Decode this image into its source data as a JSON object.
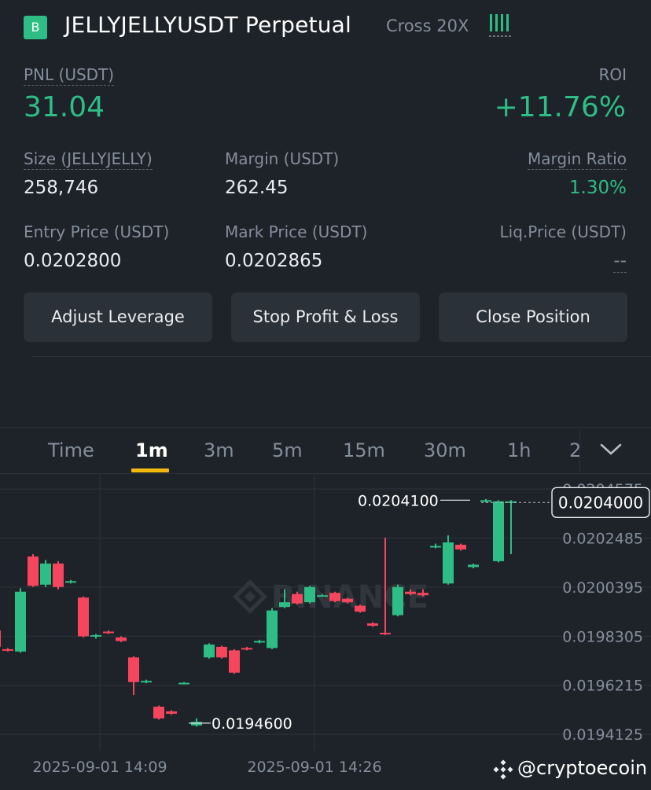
{
  "header": {
    "badge": "B",
    "title": "JELLYJELLYUSDT Perpetual",
    "mode": "Cross 20X",
    "leverage_icon": "leverage-bars-icon"
  },
  "pnl": {
    "label": "PNL (USDT)",
    "value": "31.04"
  },
  "roi": {
    "label": "ROI",
    "value": "+11.76%"
  },
  "size": {
    "label": "Size (JELLYJELLY)",
    "value": "258,746"
  },
  "margin": {
    "label": "Margin (USDT)",
    "value": "262.45"
  },
  "margin_ratio": {
    "label": "Margin Ratio",
    "value": "1.30%"
  },
  "entry_price": {
    "label": "Entry Price (USDT)",
    "value": "0.0202800"
  },
  "mark_price": {
    "label": "Mark Price (USDT)",
    "value": "0.0202865"
  },
  "liq_price": {
    "label": "Liq.Price (USDT)",
    "value": "--"
  },
  "buttons": {
    "adjust_leverage": "Adjust Leverage",
    "stop_profit_loss": "Stop Profit & Loss",
    "close_position": "Close Position"
  },
  "tabs": [
    "Time",
    "1m",
    "3m",
    "5m",
    "15m",
    "30m",
    "1h",
    "2"
  ],
  "active_tab": "1m",
  "colors": {
    "up": "#2ebd85",
    "down": "#f6465d",
    "accent": "#f0b90b",
    "bg": "#1e2329"
  },
  "chart_data": {
    "type": "candlestick",
    "y_ticks": [
      "0.0204575",
      "0.0202485",
      "0.0200395",
      "0.0198305",
      "0.0196215",
      "0.0194125"
    ],
    "x_ticks": [
      "2025-09-01 14:09",
      "2025-09-01 14:26"
    ],
    "current_price": "0.0204000",
    "high_label": "0.0204100",
    "low_label": "0.0194600",
    "watermark": "BINANCE",
    "ylim": [
      0.0193425,
      0.0205215
    ],
    "candles": [
      {
        "o": 0.019855,
        "c": 0.019785,
        "h": 0.01988,
        "l": 0.01977
      },
      {
        "o": 0.019775,
        "c": 0.01977,
        "h": 0.01978,
        "l": 0.019765
      },
      {
        "o": 0.019765,
        "c": 0.02002,
        "h": 0.020035,
        "l": 0.01976
      },
      {
        "o": 0.02017,
        "c": 0.020045,
        "h": 0.02018,
        "l": 0.02004
      },
      {
        "o": 0.02005,
        "c": 0.02014,
        "h": 0.020155,
        "l": 0.02004
      },
      {
        "o": 0.02014,
        "c": 0.02004,
        "h": 0.02015,
        "l": 0.02003
      },
      {
        "o": 0.02006,
        "c": 0.020065,
        "h": 0.02007,
        "l": 0.020055
      },
      {
        "o": 0.019995,
        "c": 0.01983,
        "h": 0.02,
        "l": 0.019825
      },
      {
        "o": 0.01983,
        "c": 0.019835,
        "h": 0.01984,
        "l": 0.01982
      },
      {
        "o": 0.01985,
        "c": 0.019845,
        "h": 0.019855,
        "l": 0.01984
      },
      {
        "o": 0.019825,
        "c": 0.01981,
        "h": 0.01983,
        "l": 0.019805
      },
      {
        "o": 0.01974,
        "c": 0.019635,
        "h": 0.019745,
        "l": 0.01958
      },
      {
        "o": 0.019635,
        "c": 0.01964,
        "h": 0.019645,
        "l": 0.01963
      },
      {
        "o": 0.01953,
        "c": 0.01948,
        "h": 0.019535,
        "l": 0.019475
      },
      {
        "o": 0.01951,
        "c": 0.0195,
        "h": 0.019515,
        "l": 0.019495
      },
      {
        "o": 0.01963,
        "c": 0.019632,
        "h": 0.019635,
        "l": 0.019625
      },
      {
        "o": 0.01945,
        "c": 0.019465,
        "h": 0.01948,
        "l": 0.019445
      },
      {
        "o": 0.01974,
        "c": 0.019795,
        "h": 0.0198,
        "l": 0.019735
      },
      {
        "o": 0.019785,
        "c": 0.01974,
        "h": 0.01979,
        "l": 0.019735
      },
      {
        "o": 0.01977,
        "c": 0.019675,
        "h": 0.019775,
        "l": 0.01967
      },
      {
        "o": 0.01978,
        "c": 0.019775,
        "h": 0.019785,
        "l": 0.01977
      },
      {
        "o": 0.019805,
        "c": 0.01981,
        "h": 0.019815,
        "l": 0.0198
      },
      {
        "o": 0.01978,
        "c": 0.01994,
        "h": 0.01995,
        "l": 0.019775
      },
      {
        "o": 0.019955,
        "c": 0.019975,
        "h": 0.02003,
        "l": 0.01995
      },
      {
        "o": 0.02001,
        "c": 0.01997,
        "h": 0.02002,
        "l": 0.019965
      },
      {
        "o": 0.019975,
        "c": 0.02004,
        "h": 0.020045,
        "l": 0.01997
      },
      {
        "o": 0.020005,
        "c": 0.020005,
        "h": 0.02001,
        "l": 0.02
      },
      {
        "o": 0.020015,
        "c": 0.01998,
        "h": 0.02002,
        "l": 0.019975
      },
      {
        "o": 0.01999,
        "c": 0.019975,
        "h": 0.019995,
        "l": 0.01997
      },
      {
        "o": 0.01996,
        "c": 0.019935,
        "h": 0.019965,
        "l": 0.01993
      },
      {
        "o": 0.019885,
        "c": 0.019875,
        "h": 0.01989,
        "l": 0.01987
      },
      {
        "o": 0.019845,
        "c": 0.01984,
        "h": 0.02025,
        "l": 0.019835
      },
      {
        "o": 0.01992,
        "c": 0.02004,
        "h": 0.02005,
        "l": 0.019915
      },
      {
        "o": 0.02002,
        "c": 0.02001,
        "h": 0.02003,
        "l": 0.020005
      },
      {
        "o": 0.020015,
        "c": 0.020005,
        "h": 0.02003,
        "l": 0.02
      },
      {
        "o": 0.020215,
        "c": 0.020215,
        "h": 0.020225,
        "l": 0.020205
      },
      {
        "o": 0.020055,
        "c": 0.02023,
        "h": 0.02026,
        "l": 0.02005
      },
      {
        "o": 0.02022,
        "c": 0.0202,
        "h": 0.020225,
        "l": 0.020195
      },
      {
        "o": 0.020125,
        "c": 0.020135,
        "h": 0.02014,
        "l": 0.02012
      },
      {
        "o": 0.020405,
        "c": 0.02041,
        "h": 0.020415,
        "l": 0.0204
      },
      {
        "o": 0.02015,
        "c": 0.020405,
        "h": 0.02041,
        "l": 0.020145
      },
      {
        "o": 0.020405,
        "c": 0.020405,
        "h": 0.02041,
        "l": 0.02018
      }
    ]
  },
  "brand": {
    "logo_icon": "binance-diamond-icon",
    "handle": "@cryptoecoin"
  }
}
